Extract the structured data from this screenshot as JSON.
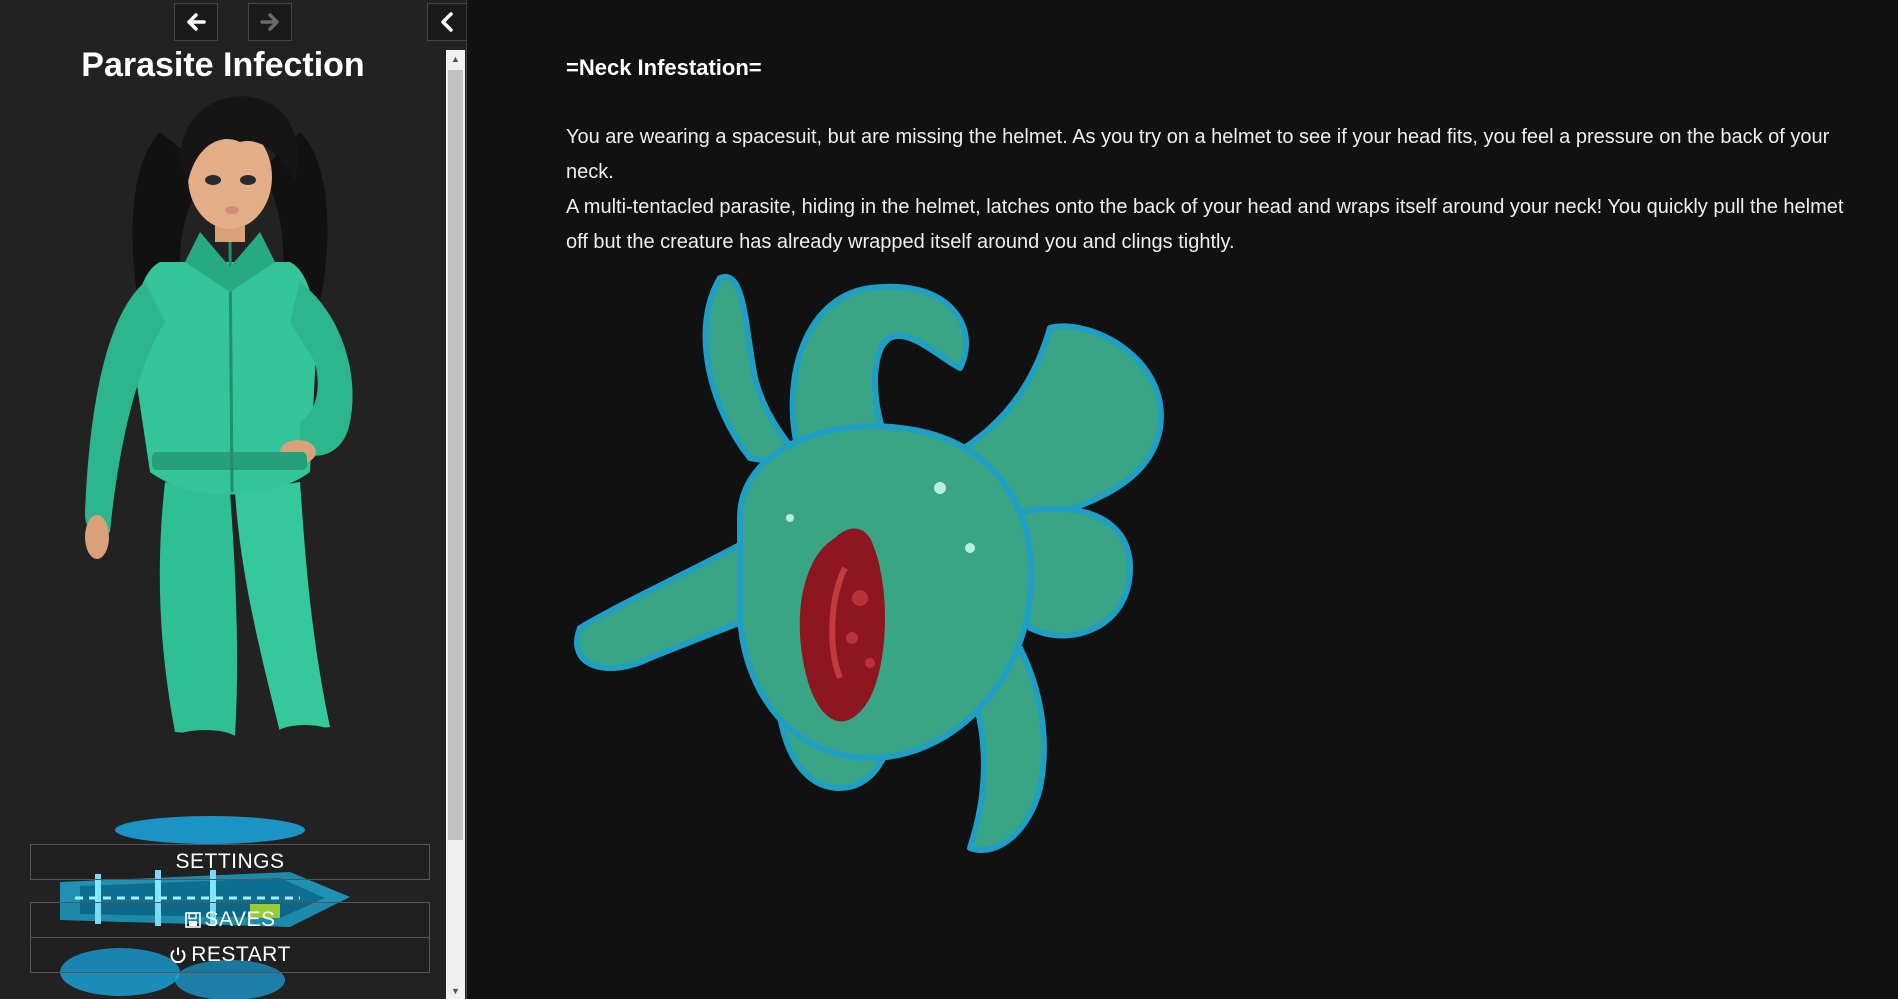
{
  "sidebar": {
    "title": "Parasite Infection",
    "menu": {
      "settings": "SETTINGS",
      "saves": "SAVES",
      "restart": "RESTART"
    }
  },
  "passage": {
    "heading": "=Neck Infestation=",
    "paragraphs": [
      "You are wearing a spacesuit, but are missing the helmet. As you try on a helmet to see if your head fits, you feel a pressure on the back of your neck.",
      "A multi-tentacled parasite, hiding in the helmet, latches onto the back of your head and wraps itself around your neck! You quickly pull the helmet off but the creature has already wrapped itself around you and clings tightly."
    ]
  },
  "icons": {
    "back": "arrow-left-icon",
    "forward": "arrow-right-icon",
    "toggle": "chevron-left-icon",
    "saves": "floppy-disk-icon",
    "restart": "power-icon"
  },
  "colors": {
    "background": "#111111",
    "sidebar": "#222222",
    "suit": "#33c49a",
    "parasite": "#3aa585",
    "parasite_outline": "#1f9fc4",
    "parasite_core": "#8e1620",
    "ship": "#1aa7e0"
  }
}
